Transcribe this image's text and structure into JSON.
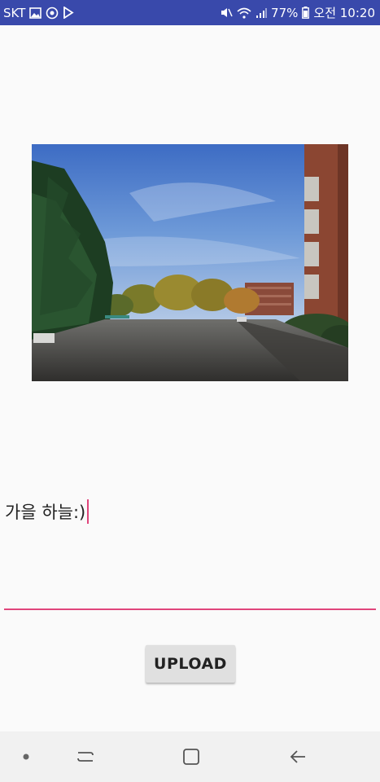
{
  "status_bar": {
    "carrier": "SKT",
    "battery": "77%",
    "time": "오전 10:20"
  },
  "main": {
    "photo_icon": "photo",
    "input": {
      "value": "가을 하늘:)"
    },
    "upload_label": "UPLOAD"
  },
  "nav_bar": {
    "icons": [
      "dot-icon",
      "recent-apps-icon",
      "home-icon",
      "back-icon"
    ]
  },
  "colors": {
    "status_bar": "#3949ab",
    "accent": "#e0457b",
    "button_bg": "#e0e0e0",
    "background": "#fafafa"
  }
}
